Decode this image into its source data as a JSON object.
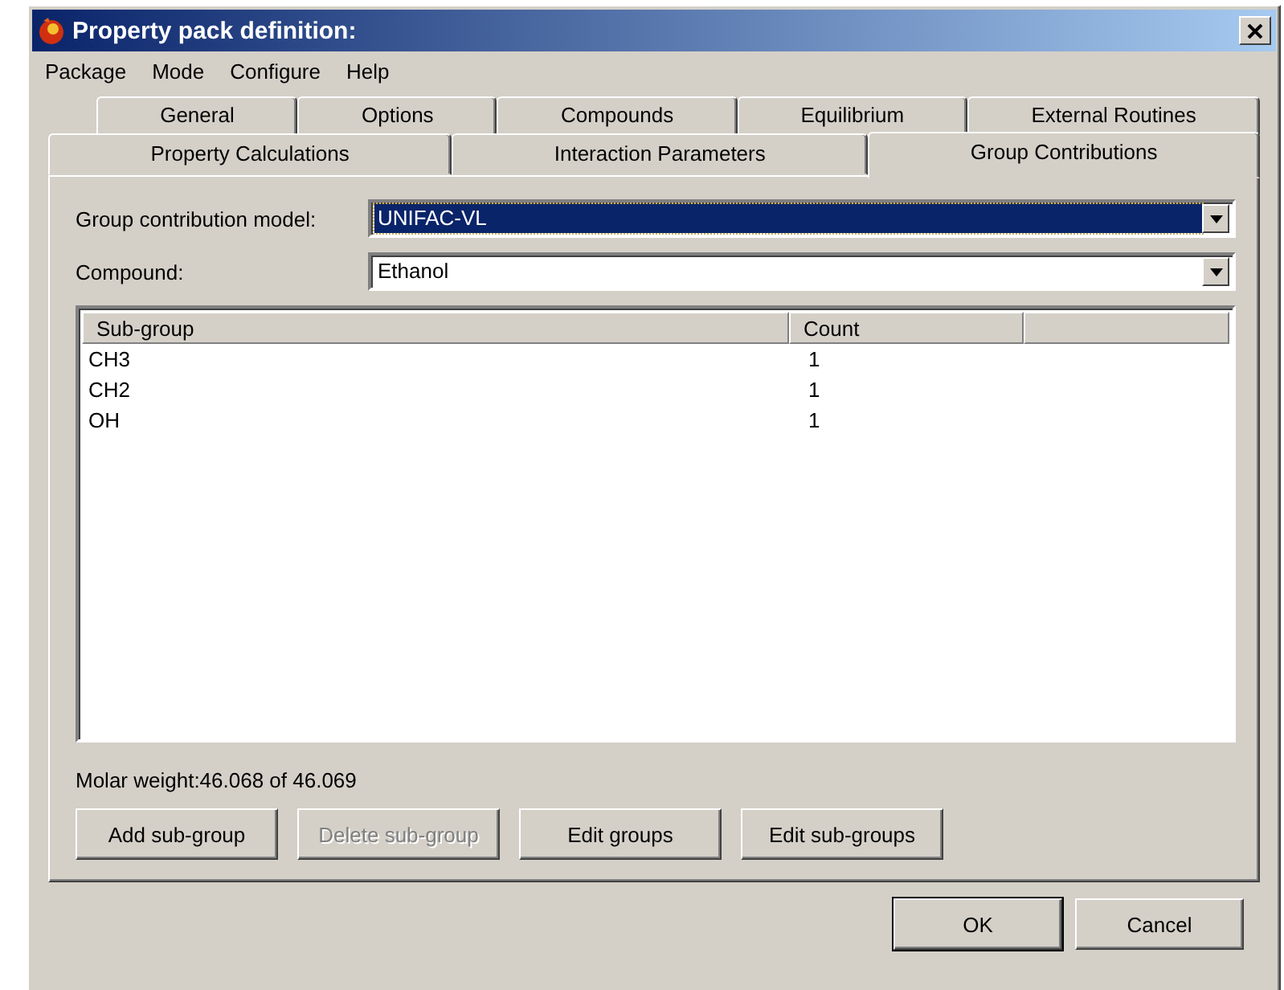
{
  "window": {
    "title": "Property pack definition:"
  },
  "menu": [
    "Package",
    "Mode",
    "Configure",
    "Help"
  ],
  "tab_rows": [
    [
      {
        "label": "General",
        "selected": false
      },
      {
        "label": "Options",
        "selected": false
      },
      {
        "label": "Compounds",
        "selected": false
      },
      {
        "label": "Equilibrium",
        "selected": false
      },
      {
        "label": "External Routines",
        "selected": false
      }
    ],
    [
      {
        "label": "Property Calculations",
        "selected": false
      },
      {
        "label": "Interaction Parameters",
        "selected": false
      },
      {
        "label": "Group Contributions",
        "selected": true
      }
    ]
  ],
  "fields": [
    {
      "label": "Group contribution model:",
      "value": "UNIFAC-VL",
      "focused": true
    },
    {
      "label": "Compound:",
      "value": "Ethanol",
      "focused": false
    }
  ],
  "table": {
    "columns": [
      "Sub-group",
      "Count"
    ],
    "rows": [
      [
        "CH3",
        "1"
      ],
      [
        "CH2",
        "1"
      ],
      [
        "OH",
        "1"
      ]
    ]
  },
  "molar_weight": "Molar weight:46.068 of 46.069",
  "buttons": [
    {
      "label": "Add sub-group",
      "disabled": false
    },
    {
      "label": "Delete sub-group",
      "disabled": true
    },
    {
      "label": "Edit groups",
      "disabled": false
    },
    {
      "label": "Edit sub-groups",
      "disabled": false
    }
  ],
  "dialog_buttons": [
    {
      "label": "OK",
      "default": true
    },
    {
      "label": "Cancel",
      "default": false
    }
  ]
}
